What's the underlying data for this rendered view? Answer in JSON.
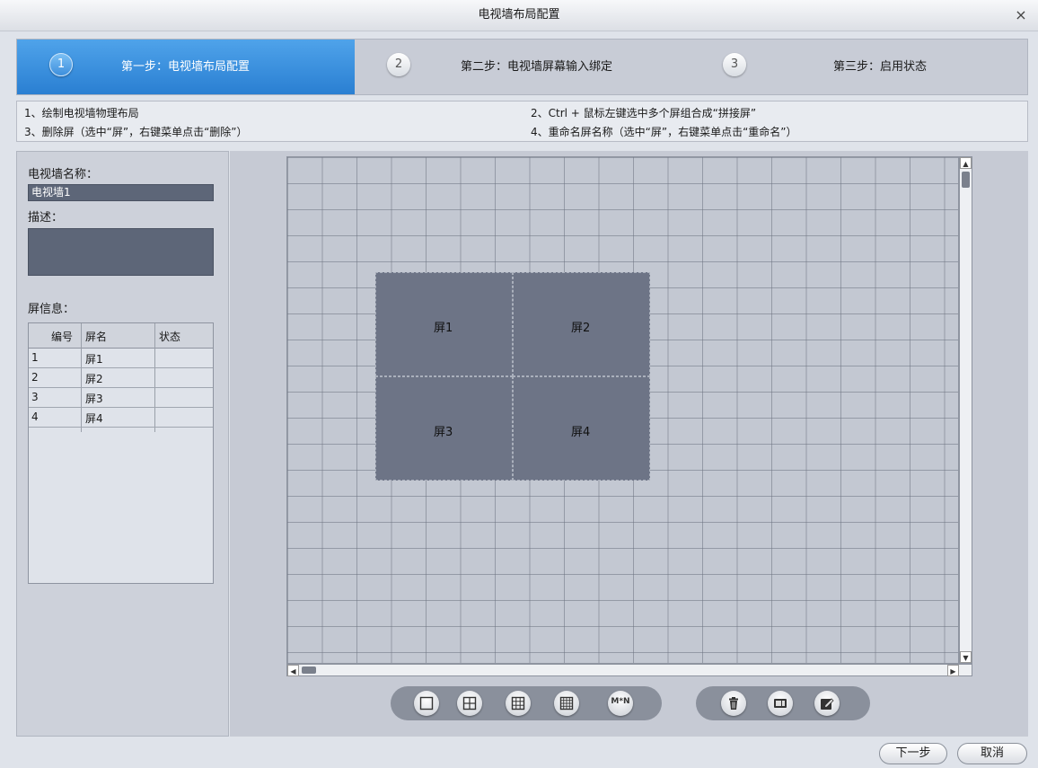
{
  "window": {
    "title": "电视墙布局配置",
    "close_glyph": "×"
  },
  "steps": [
    {
      "num": "1",
      "label": "第一步：电视墙布局配置",
      "active": true
    },
    {
      "num": "2",
      "label": "第二步：电视墙屏幕输入绑定",
      "active": false
    },
    {
      "num": "3",
      "label": "第三步：启用状态",
      "active": false
    }
  ],
  "instructions": {
    "line1": "1、绘制电视墙物理布局",
    "line2": "2、Ctrl + 鼠标左键选中多个屏组合成“拼接屏”",
    "line3": "3、删除屏（选中“屏”，右键菜单点击“删除”）",
    "line4": "4、重命名屏名称（选中“屏”，右键菜单点击“重命名”）"
  },
  "wall": {
    "name_label": "电视墙名称：",
    "name_value": "电视墙1",
    "desc_label": "描述：",
    "desc_value": ""
  },
  "screens": {
    "label": "屏信息：",
    "columns": [
      "编号",
      "屏名",
      "状态"
    ],
    "rows": [
      {
        "id": "1",
        "name": "屏1",
        "status": ""
      },
      {
        "id": "2",
        "name": "屏2",
        "status": ""
      },
      {
        "id": "3",
        "name": "屏3",
        "status": ""
      },
      {
        "id": "4",
        "name": "屏4",
        "status": ""
      }
    ]
  },
  "canvas_tiles": [
    "屏1",
    "屏2",
    "屏3",
    "屏4"
  ],
  "toolbar": {
    "layout_icons": [
      "single-screen-icon",
      "grid-2x2-icon",
      "grid-3x3-icon",
      "grid-4x4-icon",
      "custom-grid-icon"
    ],
    "custom_label": "M*N",
    "edit_icons": [
      "delete-icon",
      "screen-icon",
      "edit-icon"
    ]
  },
  "footer": {
    "next_label": "下一步",
    "cancel_label": "取消"
  },
  "colors": {
    "step_active": "#2a7fd2",
    "tile": "#6d7486",
    "input_bg": "#5d6678"
  }
}
